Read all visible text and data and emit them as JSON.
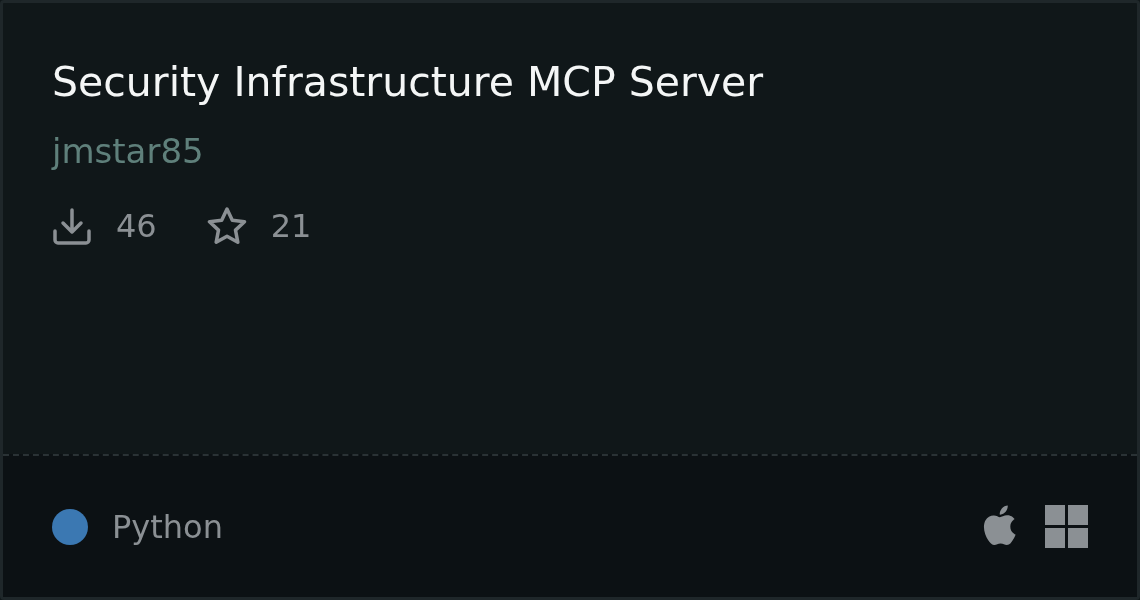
{
  "card": {
    "title": "Security Infrastructure MCP Server",
    "author": "jmstar85",
    "stats": [
      {
        "kind": "downloads",
        "value": "46"
      },
      {
        "kind": "stars",
        "value": "21"
      }
    ],
    "language": {
      "name": "Python",
      "color": "#3b78b2"
    },
    "platforms": [
      {
        "kind": "apple"
      },
      {
        "kind": "windows"
      }
    ]
  }
}
